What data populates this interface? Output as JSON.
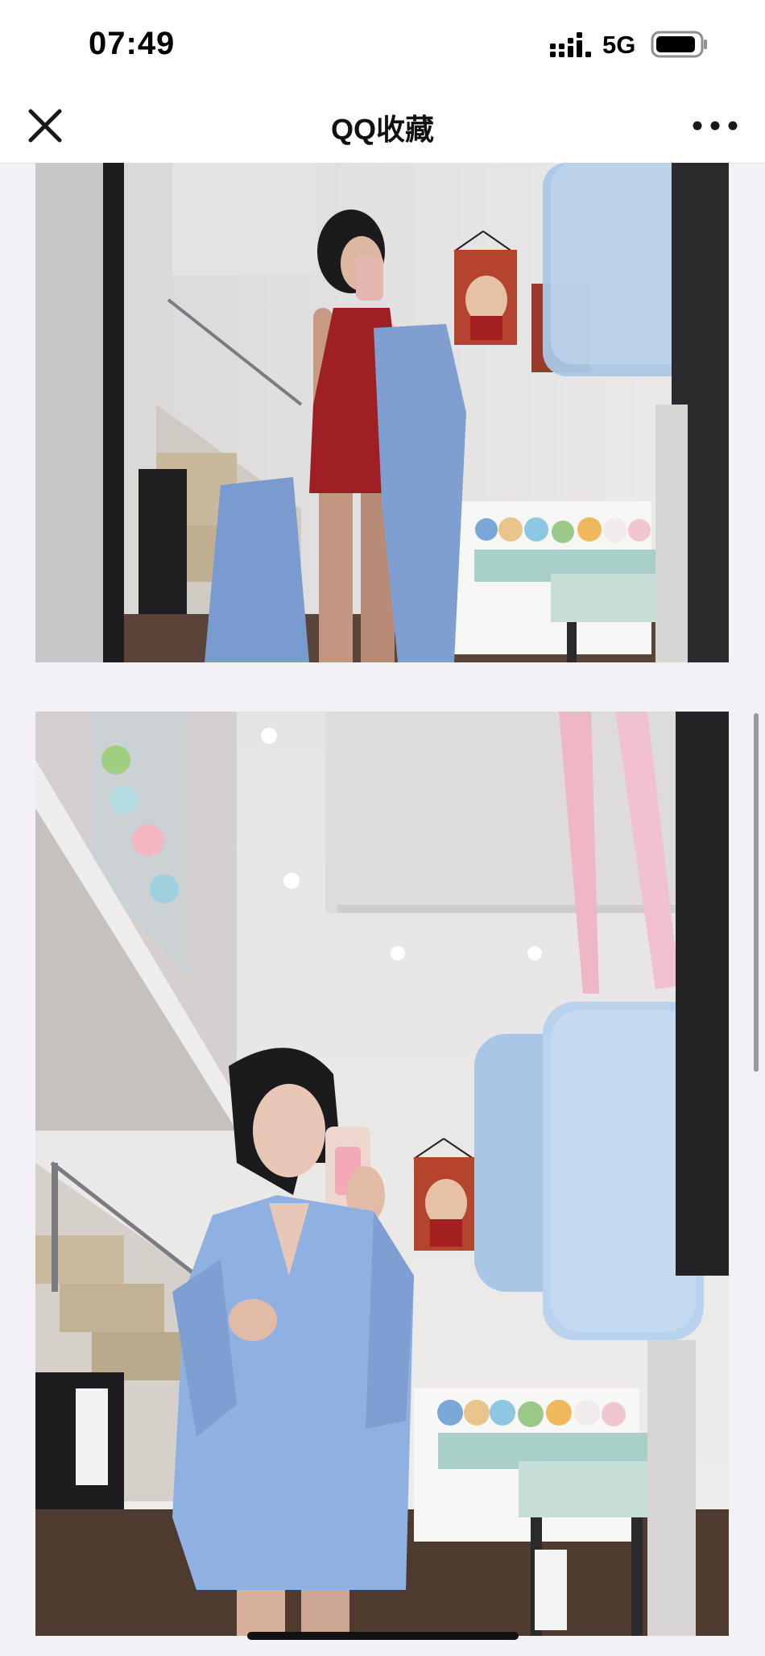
{
  "status_bar": {
    "time": "07:49",
    "network": "5G",
    "signal_icon": "cellular-signal-icon",
    "battery_icon": "battery-icon"
  },
  "nav_bar": {
    "title": "QQ收藏",
    "close_icon": "close-icon",
    "more_icon": "more-dots-icon"
  },
  "photos": [
    {
      "name": "mirror-selfie-red-dress"
    },
    {
      "name": "mirror-selfie-blue-shirt"
    }
  ],
  "colors": {
    "background": "#f2f2f6",
    "bar": "#ffffff",
    "text": "#111111"
  }
}
